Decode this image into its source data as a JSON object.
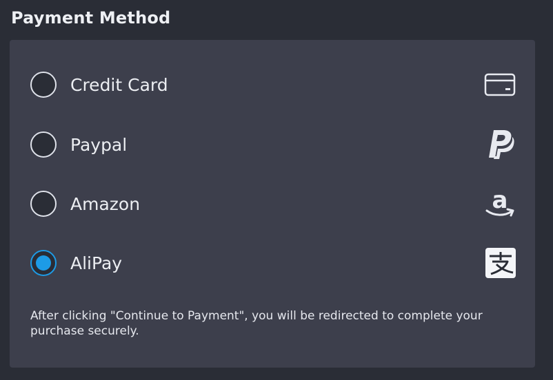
{
  "section": {
    "title": "Payment Method"
  },
  "payment_options": [
    {
      "label": "Credit Card",
      "icon": "credit-card-icon",
      "selected": false
    },
    {
      "label": "Paypal",
      "icon": "paypal-icon",
      "selected": false
    },
    {
      "label": "Amazon",
      "icon": "amazon-icon",
      "selected": false
    },
    {
      "label": "AliPay",
      "icon": "alipay-icon",
      "selected": true
    }
  ],
  "notice": "After clicking \"Continue to Payment\", you will be redirected to complete your purchase securely.",
  "colors": {
    "background": "#2a2d36",
    "panel": "#3d3f4c",
    "accent": "#1d9be6",
    "text": "#eceef2"
  }
}
